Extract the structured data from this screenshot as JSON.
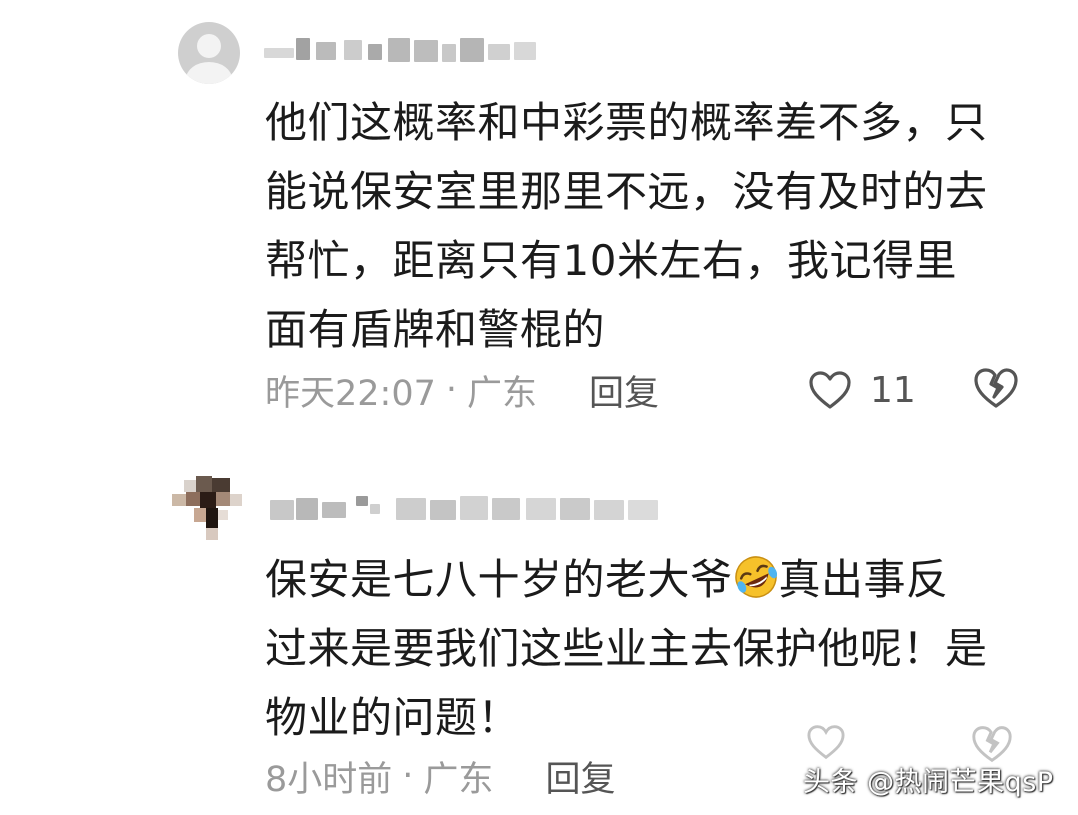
{
  "comments": [
    {
      "text": "他们这概率和中彩票的概率差不多，只\n能说保安室里那里不远，没有及时的去\n帮忙，距离只有10米左右，我记得里\n面有盾牌和警棍的",
      "time": "昨天22:07",
      "location": "广东",
      "separator": "·",
      "reply_label": "回复",
      "like_count": "11",
      "avatar_icon": "default-user-avatar-icon"
    },
    {
      "text_before_emoji": "保安是七八十岁的老大爷",
      "emoji": "rolling-laughing-emoji",
      "text_after_emoji": "真出事反\n过来是要我们这些业主去保护他呢！是\n物业的问题！",
      "time": "8小时前",
      "location": "广东",
      "separator": "·",
      "reply_label": "回复",
      "avatar_icon": "pixelated-avatar"
    }
  ],
  "watermark": "头条 @热闹芒果qsP",
  "colors": {
    "text": "#1b1b1b",
    "meta": "#9a9a9a",
    "reply": "#555555",
    "background": "#ffffff"
  }
}
